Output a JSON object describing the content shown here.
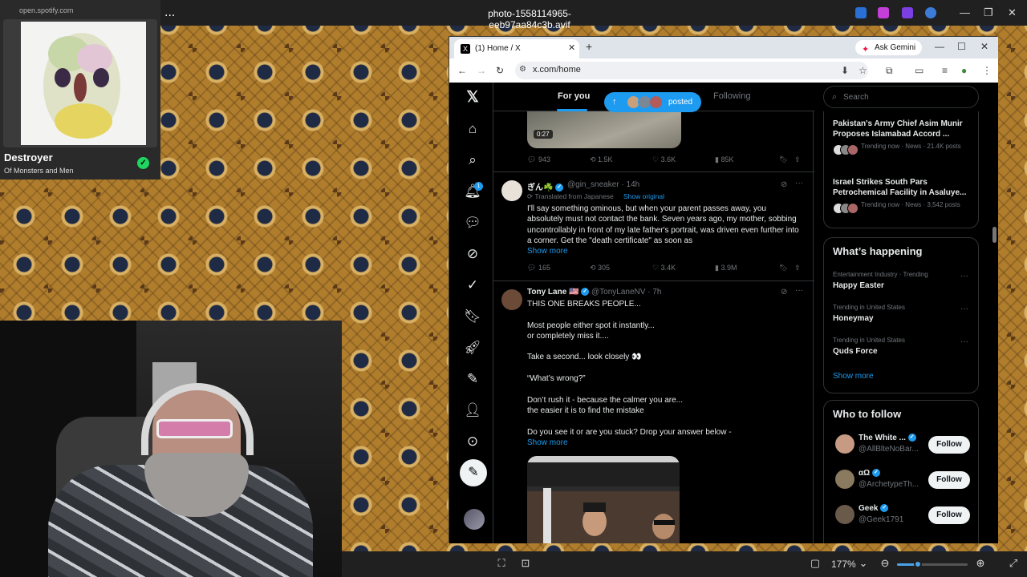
{
  "viewer": {
    "filename": "photo-1558114965-eeb97aa84c3b.avif",
    "more_label": "...",
    "zoom": "177%",
    "zoom_level_fraction": 0.3
  },
  "spotify": {
    "url": "open.spotify.com",
    "track": "Destroyer",
    "artist": "Of Monsters and Men"
  },
  "browser": {
    "tab_title": "(1) Home / X",
    "new_tab": "+",
    "ask_gemini": "Ask Gemini",
    "url": "x.com/home"
  },
  "x": {
    "tabs": {
      "for_you": "For you",
      "following": "Following"
    },
    "notifications_count": "1",
    "posted_label": "posted",
    "tweet0": {
      "duration": "0:27",
      "replies": "943",
      "reposts": "1.5K",
      "likes": "3.6K",
      "views": "85K"
    },
    "tweet1": {
      "name": "ぎん☘️",
      "handle": "@gin_sneaker · 14h",
      "translated": "Translated from Japanese",
      "show_original": "Show original",
      "body": "I'll say something ominous, but when your parent passes away, you absolutely must not contact the bank. Seven years ago, my mother, sobbing uncontrollably in front of my late father's portrait, was driven even further into a corner. Get the \"death certificate\" as soon as",
      "show_more": "Show more",
      "replies": "165",
      "reposts": "305",
      "likes": "3.4K",
      "views": "3.9M"
    },
    "tweet2": {
      "name": "Tony Lane 🇺🇸",
      "handle": "@TonyLaneNV · 7h",
      "body": "THIS ONE BREAKS PEOPLE...\n\nMost people either spot it instantly...\nor completely miss it....\n\nTake a second... look closely 👀\n\n“What’s wrong?”\n\nDon’t rush it - because the calmer you are...\nthe easier it is to find the mistake\n\nDo you see it or are you stuck? Drop your answer below -",
      "show_more": "Show more"
    },
    "search_placeholder": "Search",
    "news": [
      {
        "title": "Pakistan's Army Chief Asim Munir Proposes Islamabad Accord ...",
        "meta": "Trending now · News · 21.4K posts"
      },
      {
        "title": "Israel Strikes South Pars Petrochemical Facility in Asaluye...",
        "meta": "Trending now · News · 3,542 posts"
      }
    ],
    "whats_happening": {
      "title": "What’s happening",
      "trends": [
        {
          "category": "Entertainment Industry · Trending",
          "name": "Happy Easter"
        },
        {
          "category": "Trending in United States",
          "name": "Honeymay"
        },
        {
          "category": "Trending in United States",
          "name": "Quds Force"
        }
      ],
      "show_more": "Show more"
    },
    "who_to_follow": {
      "title": "Who to follow",
      "follow_label": "Follow",
      "accounts": [
        {
          "name": "The White ...",
          "handle": "@AllBlteNoBar..."
        },
        {
          "name": "αΩ",
          "handle": "@ArchetypeTh..."
        },
        {
          "name": "Geek",
          "handle": "@Geek1791"
        }
      ]
    }
  },
  "colors": {
    "accent": "#1d9bf0",
    "spotify_green": "#1ed760",
    "x_background": "#000000"
  }
}
